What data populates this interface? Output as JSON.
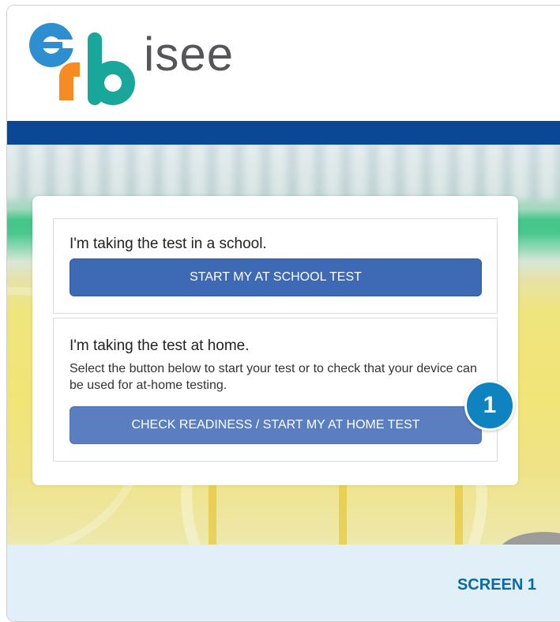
{
  "header": {
    "logo_text": "isee",
    "logo_letters": "erb"
  },
  "colors": {
    "brand_blue": "#0a4794",
    "button_blue": "#3e69b4",
    "badge_blue": "#0e83bf",
    "logo_teal": "#1aa79b",
    "logo_orange": "#f58b22",
    "logo_sky": "#2e8fd0"
  },
  "school_section": {
    "title": "I'm taking the test in a school.",
    "button_label": "START MY AT SCHOOL TEST"
  },
  "home_section": {
    "title": "I'm taking the test at home.",
    "description": "Select the button below to start your test or to check that your device can be used for at-home testing.",
    "button_label": "CHECK READINESS / START MY AT HOME TEST"
  },
  "callout": {
    "number": "1"
  },
  "footer": {
    "screen_label": "SCREEN 1"
  }
}
